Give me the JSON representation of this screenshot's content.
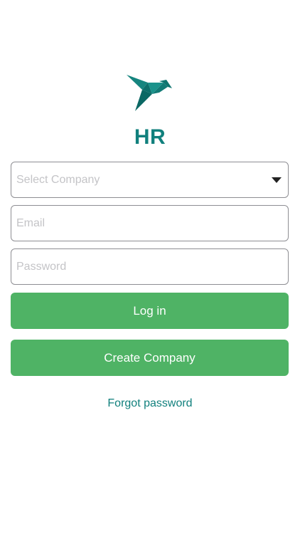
{
  "app": {
    "title": "HR",
    "logo_icon": "bird-icon",
    "brand_color": "#11807d"
  },
  "form": {
    "company_select": {
      "placeholder": "Select Company",
      "icon": "caret-down-icon"
    },
    "email": {
      "placeholder": "Email",
      "value": ""
    },
    "password": {
      "placeholder": "Password",
      "value": ""
    }
  },
  "actions": {
    "login_label": "Log in",
    "create_company_label": "Create Company",
    "forgot_password_label": "Forgot password",
    "button_color": "#4fb365"
  }
}
